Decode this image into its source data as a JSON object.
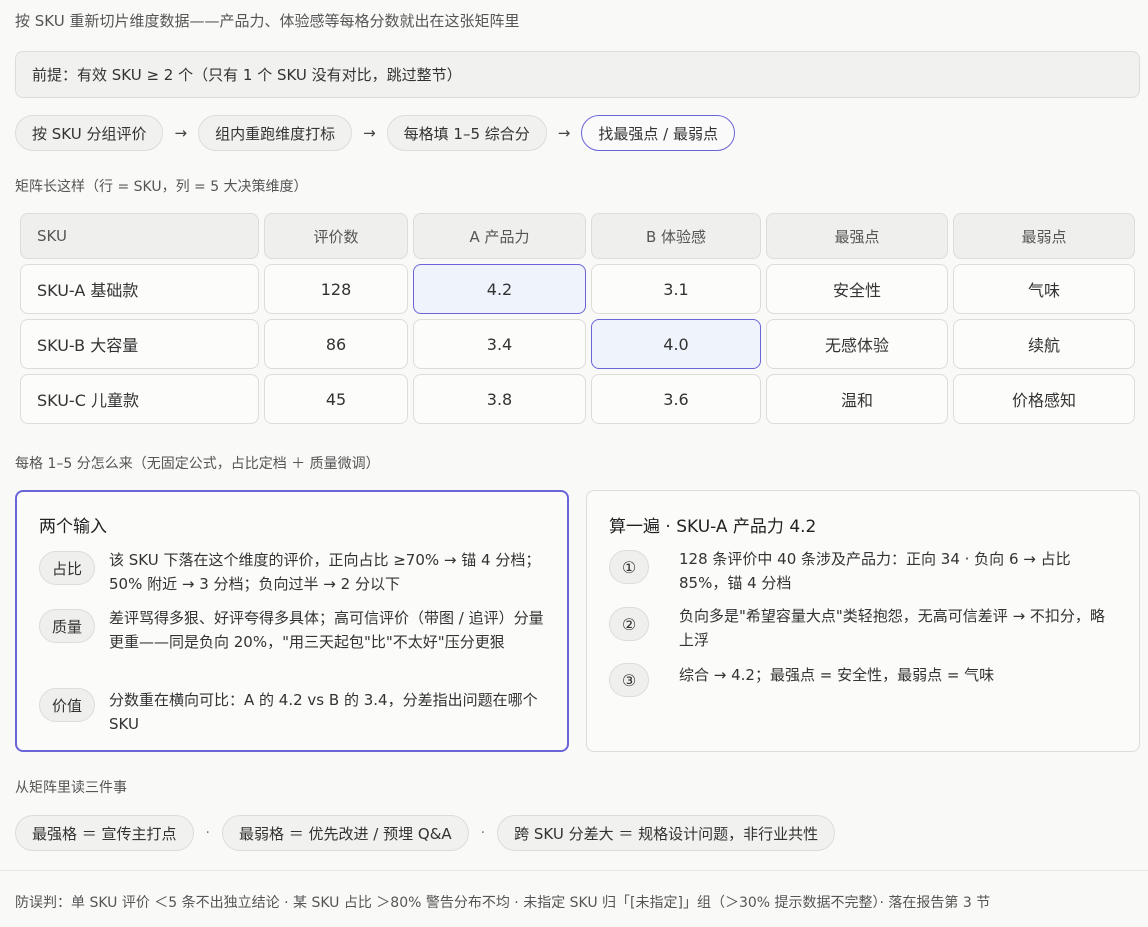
{
  "intro": "按 SKU 重新切片维度数据——产品力、体验感等每格分数就出在这张矩阵里",
  "premise": "前提：有效 SKU ≥ 2 个（只有 1 个 SKU 没有对比，跳过整节）",
  "flow": {
    "steps": [
      "按 SKU 分组评价",
      "组内重跑维度打标",
      "每格填 1–5 综合分",
      "找最强点 / 最弱点"
    ],
    "arrow": "→"
  },
  "matrix_title": "矩阵长这样（行 = SKU，列 = 5 大决策维度）",
  "matrix": {
    "headers": [
      "SKU",
      "评价数",
      "A 产品力",
      "B 体验感",
      "最强点",
      "最弱点"
    ],
    "rows": [
      [
        "SKU-A 基础款",
        "128",
        "4.2",
        "3.1",
        "安全性",
        "气味"
      ],
      [
        "SKU-B 大容量",
        "86",
        "3.4",
        "4.0",
        "无感体验",
        "续航"
      ],
      [
        "SKU-C 儿童款",
        "45",
        "3.8",
        "3.6",
        "温和",
        "价格感知"
      ]
    ]
  },
  "score_title": "每格 1–5 分怎么来（无固定公式，占比定档 ＋ 质量微调）",
  "inputs_card": {
    "title": "两个输入",
    "items": [
      {
        "tag": "占比",
        "text": "该 SKU 下落在这个维度的评价，正向占比 ≥70% → 锚 4 分档；50% 附近 → 3 分档；负向过半 → 2 分以下"
      },
      {
        "tag": "质量",
        "text": "差评骂得多狠、好评夸得多具体；高可信评价（带图 / 追评）分量更重——同是负向 20%，\"用三天起包\"比\"不太好\"压分更狠"
      },
      {
        "tag": "价值",
        "text": "分数重在横向可比：A 的 4.2 vs B 的 3.4，分差指出问题在哪个 SKU"
      }
    ]
  },
  "calc_card": {
    "title": "算一遍 · SKU-A 产品力 4.2",
    "items": [
      {
        "num": "①",
        "text": "128 条评价中 40 条涉及产品力：正向 34 · 负向 6 → 占比 85%，锚 4 分档"
      },
      {
        "num": "②",
        "text": "负向多是\"希望容量大点\"类轻抱怨，无高可信差评 → 不扣分，略上浮"
      },
      {
        "num": "③",
        "text": "综合 → 4.2；最强点 = 安全性，最弱点 = 气味"
      }
    ]
  },
  "read_title": "从矩阵里读三件事",
  "read_items": [
    "最强格 ＝ 宣传主打点",
    "最弱格 ＝ 优先改进 / 预埋 Q&A",
    "跨 SKU 分差大 ＝ 规格设计问题，非行业共性"
  ],
  "separator": "·",
  "footer": "防误判：单 SKU 评价 ＜5 条不出独立结论 · 某 SKU 占比 ＞80% 警告分布不均 · 未指定 SKU 归「[未指定]」组（＞30% 提示数据不完整）· 落在报告第 3 节"
}
